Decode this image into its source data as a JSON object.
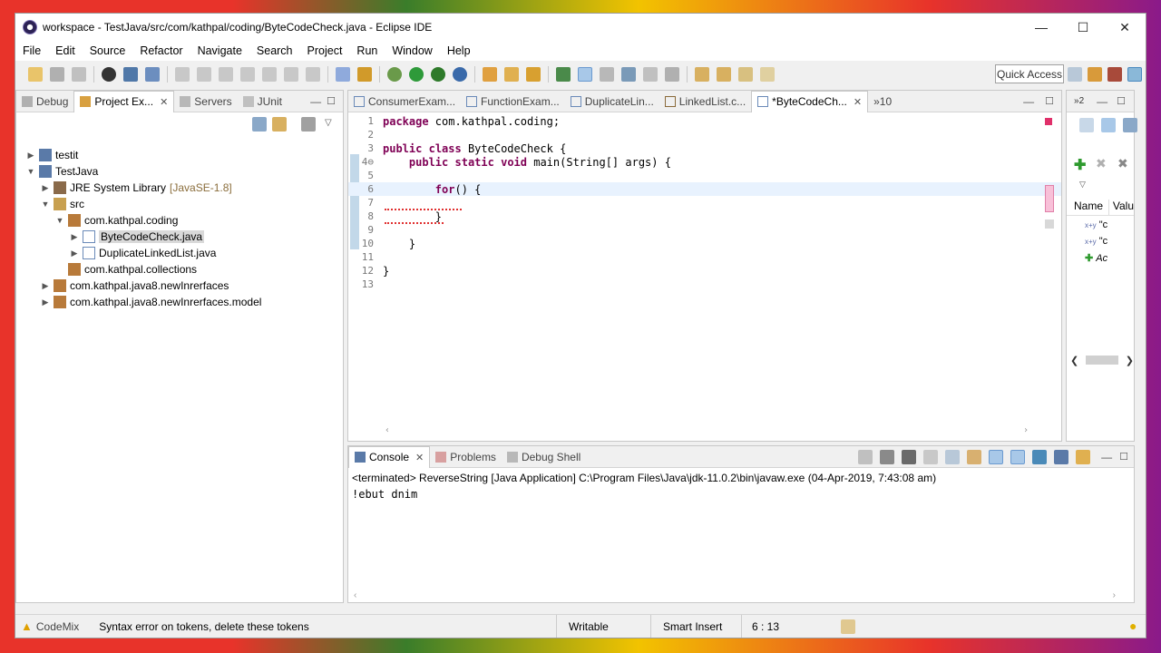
{
  "window": {
    "title": "workspace - TestJava/src/com/kathpal/coding/ByteCodeCheck.java - Eclipse IDE",
    "controls": [
      "—",
      "☐",
      "✕"
    ]
  },
  "menu": [
    "File",
    "Edit",
    "Source",
    "Refactor",
    "Navigate",
    "Search",
    "Project",
    "Run",
    "Window",
    "Help"
  ],
  "toolbar": {
    "quick_access": "Quick Access"
  },
  "left_panel": {
    "tabs": [
      {
        "label": "Debug",
        "active": false
      },
      {
        "label": "Project Ex...",
        "active": true
      },
      {
        "label": "Servers",
        "active": false
      },
      {
        "label": "JUnit",
        "active": false
      }
    ],
    "tree": [
      {
        "label": "testit",
        "suffix": "",
        "indent": 0,
        "arrow": "▶",
        "icon": "project-icon",
        "selected": false
      },
      {
        "label": "TestJava",
        "suffix": "",
        "indent": 0,
        "arrow": "▼",
        "icon": "project-icon",
        "selected": false
      },
      {
        "label": "JRE System Library",
        "suffix": "[JavaSE-1.8]",
        "indent": 1,
        "arrow": "▶",
        "icon": "library-icon",
        "selected": false
      },
      {
        "label": "src",
        "suffix": "",
        "indent": 1,
        "arrow": "▼",
        "icon": "source-folder-icon",
        "selected": false
      },
      {
        "label": "com.kathpal.coding",
        "suffix": "",
        "indent": 2,
        "arrow": "▼",
        "icon": "package-icon",
        "selected": false
      },
      {
        "label": "ByteCodeCheck.java",
        "suffix": "",
        "indent": 3,
        "arrow": "▶",
        "icon": "java-file-icon",
        "selected": true
      },
      {
        "label": "DuplicateLinkedList.java",
        "suffix": "",
        "indent": 3,
        "arrow": "▶",
        "icon": "java-file-icon",
        "selected": false
      },
      {
        "label": "com.kathpal.collections",
        "suffix": "",
        "indent": 2,
        "arrow": "",
        "icon": "package-icon",
        "selected": false
      },
      {
        "label": "com.kathpal.java8.newInrerfaces",
        "suffix": "",
        "indent": 1,
        "arrow": "▶",
        "icon": "package-icon",
        "selected": false
      },
      {
        "label": "com.kathpal.java8.newInrerfaces.model",
        "suffix": "",
        "indent": 1,
        "arrow": "▶",
        "icon": "package-icon",
        "selected": false
      }
    ]
  },
  "editor": {
    "tabs": [
      {
        "label": "ConsumerExam...",
        "active": false
      },
      {
        "label": "FunctionExam...",
        "active": false
      },
      {
        "label": "DuplicateLin...",
        "active": false
      },
      {
        "label": "LinkedList.c...",
        "active": false
      },
      {
        "label": "*ByteCodeCh...",
        "active": true
      }
    ],
    "overflow": "»10",
    "lines": [
      {
        "n": "1",
        "code": "package com.kathpal.coding;"
      },
      {
        "n": "2",
        "code": ""
      },
      {
        "n": "3",
        "code": "public class ByteCodeCheck {"
      },
      {
        "n": "4⊖",
        "code": "    public static void main(String[] args) {"
      },
      {
        "n": "5",
        "code": ""
      },
      {
        "n": "6",
        "code": "        for() {"
      },
      {
        "n": "7",
        "code": ""
      },
      {
        "n": "8",
        "code": "        }"
      },
      {
        "n": "9",
        "code": ""
      },
      {
        "n": "10",
        "code": "    }"
      },
      {
        "n": "11",
        "code": ""
      },
      {
        "n": "12",
        "code": "}"
      },
      {
        "n": "13",
        "code": ""
      }
    ]
  },
  "right_panel": {
    "tab_count": "2",
    "columns": [
      "Name",
      "Valu"
    ],
    "rows": [
      "\"c",
      "\"c",
      "Ac"
    ]
  },
  "console": {
    "tabs": [
      {
        "label": "Console",
        "active": true
      },
      {
        "label": "Problems",
        "active": false
      },
      {
        "label": "Debug Shell",
        "active": false
      }
    ],
    "header": "<terminated> ReverseString [Java Application] C:\\Program Files\\Java\\jdk-11.0.2\\bin\\javaw.exe (04-Apr-2019, 7:43:08 am)",
    "output": "!ebut dnim"
  },
  "status": {
    "codemix": "CodeMix",
    "message": "Syntax error on tokens, delete these tokens",
    "writable": "Writable",
    "insert": "Smart Insert",
    "position": "6 : 13"
  },
  "colors": {
    "keyword": "#7f0055",
    "accent": "#4a90d9"
  }
}
